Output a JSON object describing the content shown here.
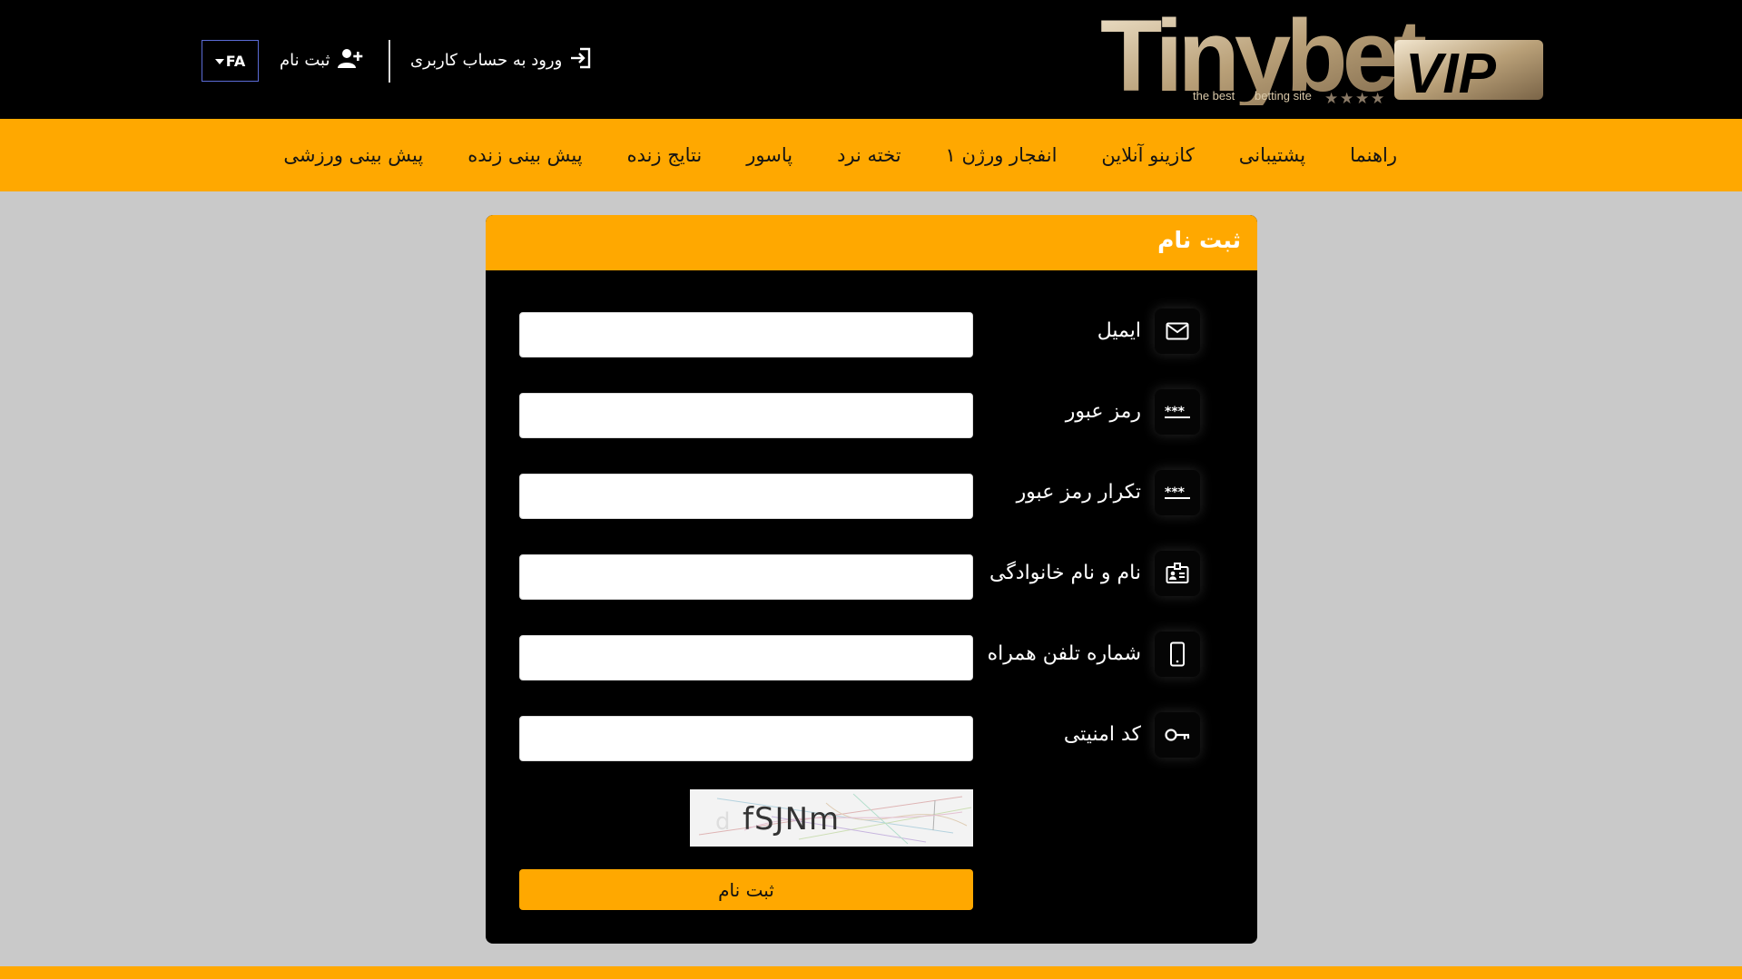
{
  "brand": {
    "logo_main": "Tinybet",
    "logo_badge": "VIP",
    "tagline_left": "the best",
    "tagline_right": "betting site"
  },
  "header": {
    "lang": "FA",
    "register_label": "ثبت نام",
    "login_label": "ورود به حساب کاربری"
  },
  "nav": {
    "items": [
      {
        "label": "پیش بینی ورزشی"
      },
      {
        "label": "پیش بینی زنده"
      },
      {
        "label": "نتایج زنده"
      },
      {
        "label": "پاسور"
      },
      {
        "label": "تخته نرد"
      },
      {
        "label": "انفجار ورژن ۱"
      },
      {
        "label": "کازینو آنلاین"
      },
      {
        "label": "پشتیبانی"
      },
      {
        "label": "راهنما"
      }
    ]
  },
  "form": {
    "title": "ثبت نام",
    "fields": [
      {
        "label": "ایمیل",
        "icon": "mail-icon",
        "value": ""
      },
      {
        "label": "رمز عبور",
        "icon": "password-icon",
        "value": ""
      },
      {
        "label": "تکرار رمز عبور",
        "icon": "password-icon",
        "value": ""
      },
      {
        "label": "نام و نام خانوادگی",
        "icon": "id-card-icon",
        "value": ""
      },
      {
        "label": "شماره تلفن همراه",
        "icon": "mobile-icon",
        "value": ""
      },
      {
        "label": "کد امنیتی",
        "icon": "key-icon",
        "value": ""
      }
    ],
    "captcha_text": "fSJNm",
    "submit_label": "ثبت نام"
  },
  "colors": {
    "accent": "#ffa800",
    "header_bg": "#000000",
    "page_bg": "#c9c9c9",
    "card_bg": "#000000"
  }
}
